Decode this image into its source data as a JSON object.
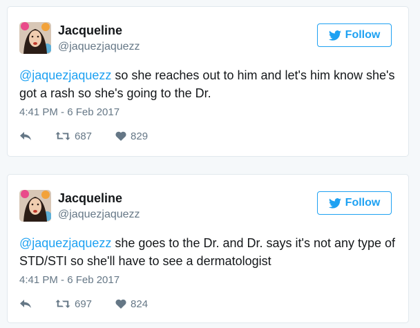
{
  "tweets": [
    {
      "display_name": "Jacqueline",
      "handle": "@jaquezjaquezz",
      "follow_label": "Follow",
      "mention": "@jaquezjaquezz",
      "text": " so she reaches out to him and let's him know she's got a rash so she's going to the Dr.",
      "timestamp": "4:41 PM - 6 Feb 2017",
      "retweets": "687",
      "likes": "829"
    },
    {
      "display_name": "Jacqueline",
      "handle": "@jaquezjaquezz",
      "follow_label": "Follow",
      "mention": "@jaquezjaquezz",
      "text": " she goes to the Dr. and Dr. says it's not any type of STD/STI so she'll have to see a dermatologist",
      "timestamp": "4:41 PM - 6 Feb 2017",
      "retweets": "697",
      "likes": "824"
    }
  ],
  "colors": {
    "accent": "#1da1f2",
    "muted": "#657786",
    "text": "#14171a",
    "border": "#e1e8ed",
    "background": "#f5f8fa"
  },
  "icons": {
    "follow": "bird-icon",
    "reply": "reply-icon",
    "retweet": "retweet-icon",
    "like": "heart-icon"
  }
}
